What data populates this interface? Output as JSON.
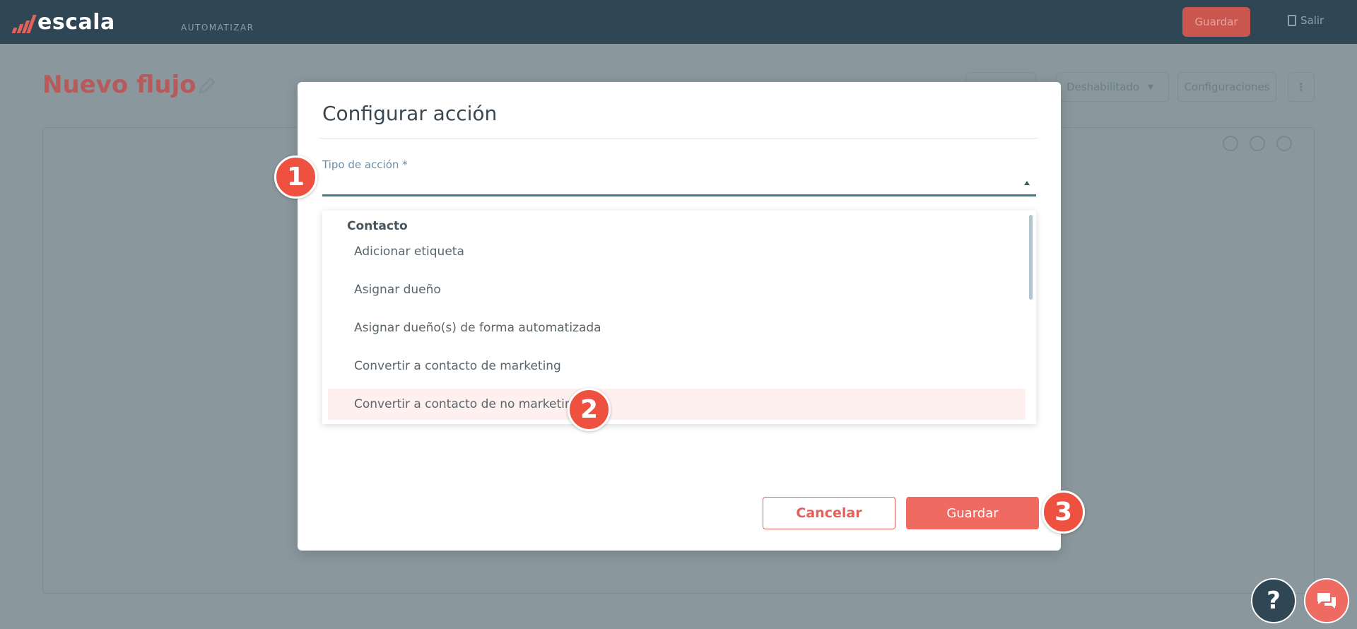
{
  "app": {
    "logo_text": "escala",
    "nav_item": "AUTOMATIZAR",
    "save_label": "Guardar",
    "exit_label": "Salir"
  },
  "page": {
    "title": "Nuevo flujo",
    "status_label": "Deshabilitado",
    "config_label": "Configuraciones",
    "more_label": "⋮"
  },
  "modal": {
    "title": "Configurar acción",
    "field_label": "Tipo de acción *",
    "dropdown": {
      "group": "Contacto",
      "options": [
        "Adicionar etiqueta",
        "Asignar dueño",
        "Asignar dueño(s) de forma automatizada",
        "Convertir a contacto de marketing",
        "Convertir a contacto de no marketing"
      ],
      "highlighted_index": 4
    },
    "cancel_label": "Cancelar",
    "save_label": "Guardar"
  },
  "steps": [
    "1",
    "2",
    "3"
  ],
  "help_label": "?",
  "colors": {
    "brand": "#ef6a61",
    "navy": "#2f4655",
    "accent_teal": "#3d7e8d",
    "step_marker": "#ee5140"
  }
}
